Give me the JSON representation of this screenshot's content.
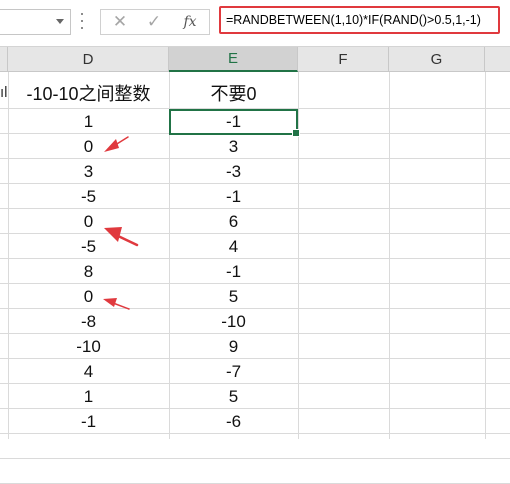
{
  "formula_bar": {
    "name_box": "",
    "cancel_glyph": "✕",
    "enter_glyph": "✓",
    "fx_label": "fx",
    "formula": "=RANDBETWEEN(1,10)*IF(RAND()>0.5,1,-1)"
  },
  "columns": {
    "d": "D",
    "e": "E",
    "f": "F",
    "g": "G"
  },
  "header_row": {
    "d": "-10-10之间整数",
    "e": "不要0"
  },
  "left_fragment": "ıl",
  "rows": [
    {
      "d": "1",
      "e": "-1"
    },
    {
      "d": "0",
      "e": "3"
    },
    {
      "d": "3",
      "e": "-3"
    },
    {
      "d": "-5",
      "e": "-1"
    },
    {
      "d": "0",
      "e": "6"
    },
    {
      "d": "-5",
      "e": "4"
    },
    {
      "d": "8",
      "e": "-1"
    },
    {
      "d": "0",
      "e": "5"
    },
    {
      "d": "-8",
      "e": "-10"
    },
    {
      "d": "-10",
      "e": "9"
    },
    {
      "d": "4",
      "e": "-7"
    },
    {
      "d": "1",
      "e": "5"
    },
    {
      "d": "-1",
      "e": "-6"
    }
  ],
  "colors": {
    "annotation_red": "#e0393e",
    "excel_green": "#217346"
  }
}
